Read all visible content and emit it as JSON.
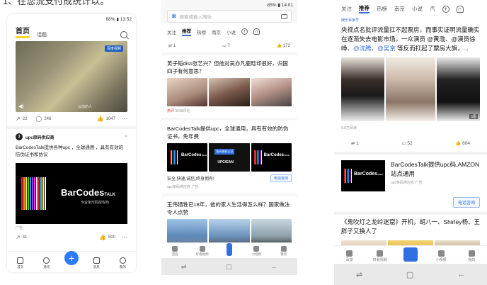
{
  "top_caption": "1、在您流支付成统计以。",
  "phone1": {
    "status": "88% ▮ 13:52",
    "tabs": {
      "home": "首页",
      "topic": "话题"
    },
    "video": {
      "badge": "百度视频",
      "caption": "以前的人"
    },
    "post1_stats": {
      "share": "22",
      "comment": "246",
      "like": "1047"
    },
    "ad": {
      "account": "upc串码供应商",
      "text": "BarCodesTalk提供各种upc ，全球通用 ，具有有效的防伪证书和协议",
      "brand": "BarCodes",
      "brand_suffix": "TALK",
      "sub": "专业条形码授权商",
      "label": "广告"
    },
    "post2_stats": {
      "share": "41",
      "like": "800"
    },
    "nav": {
      "home": "首页",
      "feed": "通讯",
      "msg": "消息",
      "me": "我的"
    }
  },
  "phone2": {
    "status": "85% ▮ 14:01",
    "search_placeholder": "搜索或输入网址",
    "tabs": [
      "关注",
      "推荐",
      "热榜",
      "南京",
      "小说"
    ],
    "share_stats": {
      "share": "1",
      "comment": "7",
      "like": "172"
    },
    "news1": {
      "title": "黄子韬diss张艺兴？但他对吴亦凡鹿晗却很好，归国四子有何意思？",
      "hot": "热评",
      "comments": "3698评论"
    },
    "ad": {
      "title": "BarCodesTalk提供upc，全球通用，具有有效的防伪证书，免年费",
      "slogan": "安全,快速,诚信,终身拥有!",
      "button": "电话咨询",
      "meta": "upc条码供应商  广告",
      "img2_line1": "条码授权认证",
      "img2_line2": "UPC/EAN"
    },
    "news2": {
      "title": "王伟牺牲已18年，他的家人生活得怎么样？国家做法令人点赞"
    },
    "nav": {
      "home": "百度",
      "video": "好看视频",
      "mini": "小视频",
      "me": "我的"
    }
  },
  "phone3": {
    "tabs": [
      "关注",
      "推荐",
      "热榜",
      "南京",
      "小说",
      "汽"
    ],
    "source": "娱乐百家号",
    "headline_a": "央视点名批评流量扛不起票房，而事实证明流量确实在逐渐失去电影市场。一众演员 @黄渤、@演员徐峥、",
    "headline_at1": "@沈腾",
    "headline_mid": "、",
    "headline_at2": "@吴京",
    "headline_b": " 等反而扛起了票房大旗，...",
    "img_count": "6图",
    "reads": "9.8万阅读",
    "stats": {
      "share": "1",
      "comment": "52",
      "like": "604"
    },
    "ad": {
      "title": "BarCodesTalk提供upc码,AMZON站点通用",
      "meta": "upc条码供应商  广告",
      "button": "电话咨询",
      "brand": "BarCodes",
      "brand_suffix": "TALK"
    },
    "news2": "《鬼吹灯之龙岭迷窟》开机，胡八一、Shirley杨、王胖子又换人了",
    "nav": {
      "home": "百度",
      "video": "好看视频",
      "mini": "小视频",
      "me": "我的"
    }
  }
}
